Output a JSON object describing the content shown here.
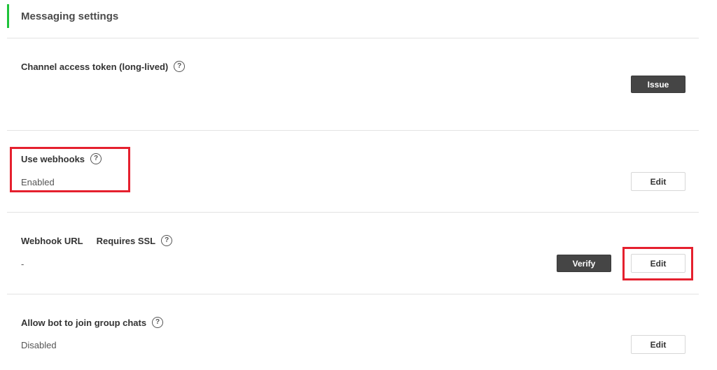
{
  "header": {
    "title": "Messaging settings",
    "accent_color": "#1ec33a"
  },
  "rows": {
    "access_token": {
      "label": "Channel access token (long-lived)",
      "help_icon": "question-circle-icon",
      "button_label": "Issue"
    },
    "use_webhooks": {
      "label": "Use webhooks",
      "help_icon": "question-circle-icon",
      "value": "Enabled",
      "button_label": "Edit"
    },
    "webhook_url": {
      "label": "Webhook URL",
      "sub_label": "Requires SSL",
      "help_icon": "question-circle-icon",
      "value": "-",
      "verify_label": "Verify",
      "button_label": "Edit"
    },
    "group_chats": {
      "label": "Allow bot to join group chats",
      "help_icon": "question-circle-icon",
      "value": "Disabled",
      "button_label": "Edit"
    }
  },
  "help_glyph": "?",
  "highlight_color": "#e5202e"
}
